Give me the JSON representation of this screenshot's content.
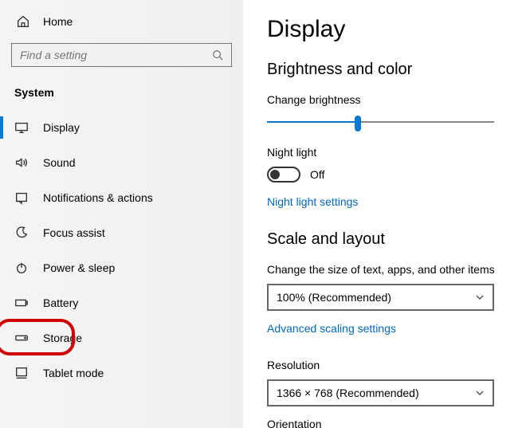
{
  "sidebar": {
    "home": "Home",
    "search_placeholder": "Find a setting",
    "section": "System",
    "items": [
      {
        "label": "Display",
        "icon": "monitor",
        "active": true
      },
      {
        "label": "Sound",
        "icon": "speaker"
      },
      {
        "label": "Notifications & actions",
        "icon": "notification"
      },
      {
        "label": "Focus assist",
        "icon": "moon"
      },
      {
        "label": "Power & sleep",
        "icon": "power"
      },
      {
        "label": "Battery",
        "icon": "battery"
      },
      {
        "label": "Storage",
        "icon": "drive",
        "highlighted": true
      },
      {
        "label": "Tablet mode",
        "icon": "tablet"
      }
    ]
  },
  "main": {
    "title": "Display",
    "brightness_section": "Brightness and color",
    "brightness_label": "Change brightness",
    "brightness_percent": 40,
    "nightlight_label": "Night light",
    "nightlight_state": "Off",
    "nightlight_link": "Night light settings",
    "scale_section": "Scale and layout",
    "scale_label": "Change the size of text, apps, and other items",
    "scale_value": "100% (Recommended)",
    "scaling_link": "Advanced scaling settings",
    "resolution_label": "Resolution",
    "resolution_value": "1366 × 768 (Recommended)",
    "orientation_label": "Orientation"
  },
  "colors": {
    "accent": "#0078d4",
    "link": "#0067c0",
    "highlight": "#d00000"
  }
}
